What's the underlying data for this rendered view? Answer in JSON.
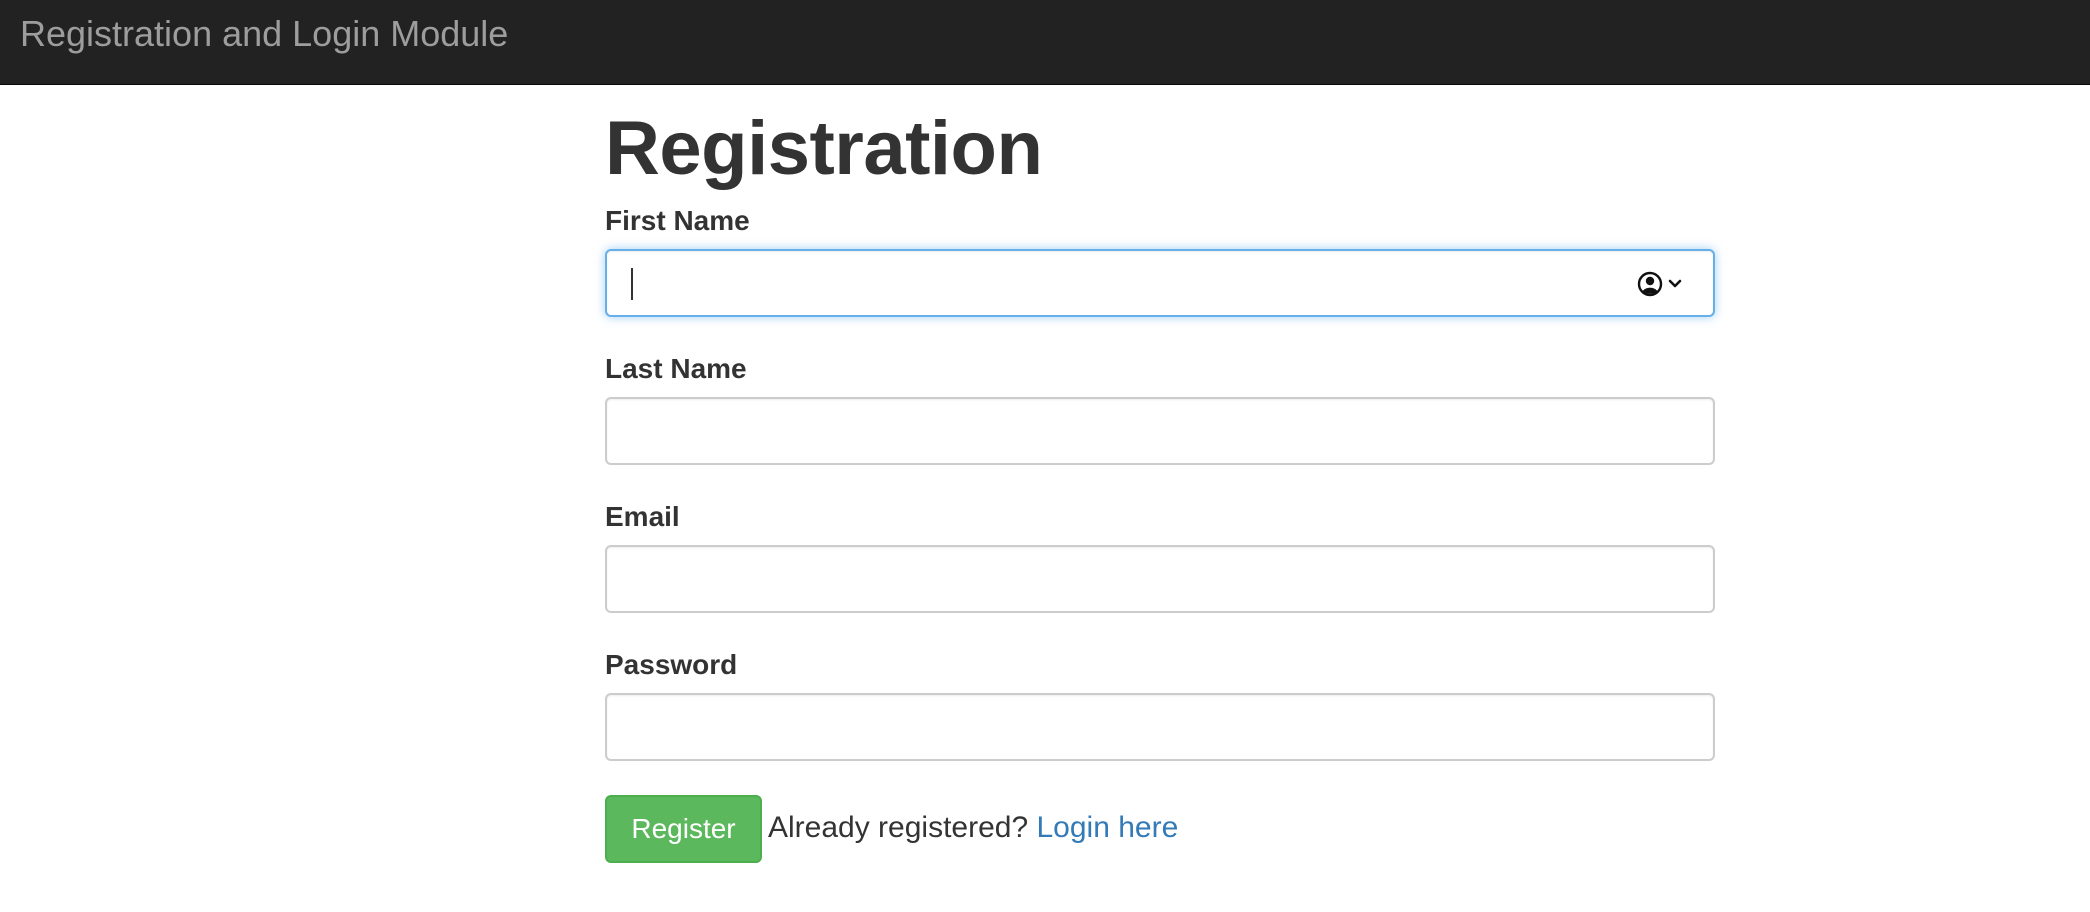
{
  "navbar": {
    "brand": "Registration and Login Module"
  },
  "page": {
    "title": "Registration"
  },
  "form": {
    "first_name": {
      "label": "First Name",
      "value": "",
      "placeholder": ""
    },
    "last_name": {
      "label": "Last Name",
      "value": "",
      "placeholder": ""
    },
    "email": {
      "label": "Email",
      "value": "",
      "placeholder": ""
    },
    "password": {
      "label": "Password",
      "value": "",
      "placeholder": ""
    },
    "autofill_icon": "contact-autofill-icon"
  },
  "actions": {
    "register_label": "Register",
    "already_text": "Already registered?",
    "login_link": "Login here"
  },
  "colors": {
    "navbar_bg": "#222222",
    "brand_text": "#9d9d9d",
    "button_success": "#5cb85c",
    "link": "#337ab7",
    "focus_border": "#66afe9"
  }
}
